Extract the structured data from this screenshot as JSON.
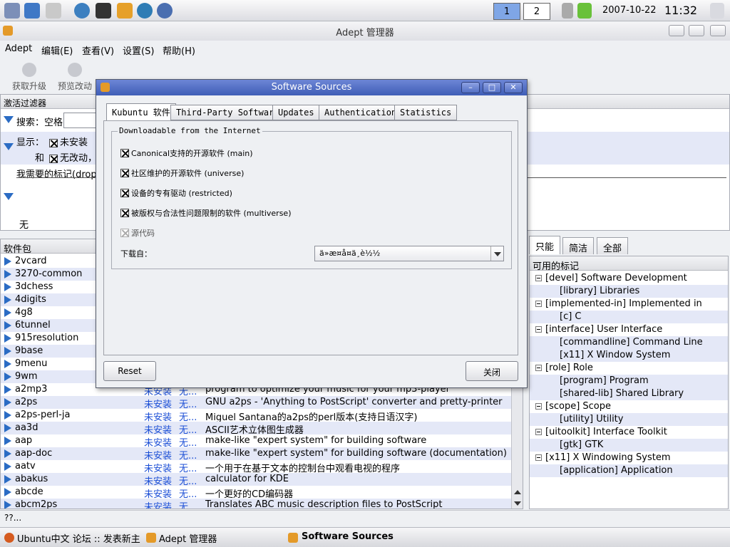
{
  "panel": {
    "launchers": [
      "ubuntu-menu-icon",
      "desktop-icon",
      "settings-icon",
      "konqueror-icon",
      "terminal-icon",
      "package-manager-icon",
      "konsole-icon",
      "network-icon"
    ],
    "desktop1": "1",
    "desktop2": "2",
    "date": "2007-10-22",
    "time": "11:32"
  },
  "window": {
    "title": "Adept 管理器"
  },
  "menu": {
    "items": [
      "Adept",
      "编辑(E)",
      "查看(V)",
      "设置(S)",
      "帮助(H)"
    ]
  },
  "toolbar": {
    "fetch_updates": "获取升级",
    "preview_changes": "预览改动"
  },
  "filter": {
    "header": "激活过滤器",
    "search_label": "搜索：空格",
    "show_label": "显示：",
    "not_installed": "未安装",
    "and_label": "和",
    "no_change": "无改动，",
    "tags_label": "我需要的标记(drop",
    "none": "无"
  },
  "pkglist": {
    "header": "软件包",
    "status_not_installed": "未安装",
    "action": "无...",
    "rows": [
      {
        "name": "2vcard",
        "desc": ""
      },
      {
        "name": "3270-common",
        "desc": ""
      },
      {
        "name": "3dchess",
        "desc": ""
      },
      {
        "name": "4digits",
        "desc": ""
      },
      {
        "name": "4g8",
        "desc": ""
      },
      {
        "name": "6tunnel",
        "desc": ""
      },
      {
        "name": "915resolution",
        "desc": ""
      },
      {
        "name": "9base",
        "desc": ""
      },
      {
        "name": "9menu",
        "desc": ""
      },
      {
        "name": "9wm",
        "desc": ""
      },
      {
        "name": "a2mp3",
        "desc": "program to optimize your music for your mp3-player"
      },
      {
        "name": "a2ps",
        "desc": "GNU a2ps - 'Anything to PostScript' converter and pretty-printer"
      },
      {
        "name": "a2ps-perl-ja",
        "desc": "Miguel Santana的a2ps的perl版本(支持日语汉字)"
      },
      {
        "name": "aa3d",
        "desc": "ASCII艺术立体图生成器"
      },
      {
        "name": "aap",
        "desc": "make-like \"expert system\" for building software"
      },
      {
        "name": "aap-doc",
        "desc": "make-like \"expert system\" for building software (documentation)"
      },
      {
        "name": "aatv",
        "desc": "一个用于在基于文本的控制台中观看电视的程序"
      },
      {
        "name": "abakus",
        "desc": "calculator for KDE"
      },
      {
        "name": "abcde",
        "desc": "一个更好的CD编码器"
      },
      {
        "name": "abcm2ps",
        "desc": "Translates ABC music description files to PostScript"
      }
    ]
  },
  "tags": {
    "tabs": [
      "只能",
      "简洁",
      "全部"
    ],
    "header": "可用的标记",
    "tree": [
      {
        "label": "[devel] Software Development",
        "level": 0
      },
      {
        "label": "[library] Libraries",
        "level": 1
      },
      {
        "label": "[implemented-in] Implemented in",
        "level": 0
      },
      {
        "label": "[c] C",
        "level": 1
      },
      {
        "label": "[interface] User Interface",
        "level": 0
      },
      {
        "label": "[commandline] Command Line",
        "level": 1
      },
      {
        "label": "[x11] X Window System",
        "level": 1
      },
      {
        "label": "[role] Role",
        "level": 0
      },
      {
        "label": "[program] Program",
        "level": 1
      },
      {
        "label": "[shared-lib] Shared Library",
        "level": 1
      },
      {
        "label": "[scope] Scope",
        "level": 0
      },
      {
        "label": "[utility] Utility",
        "level": 1
      },
      {
        "label": "[uitoolkit] Interface Toolkit",
        "level": 0
      },
      {
        "label": "[gtk] GTK",
        "level": 1
      },
      {
        "label": "[x11] X Windowing System",
        "level": 0
      },
      {
        "label": "[application] Application",
        "level": 1
      }
    ]
  },
  "status_text": "??...",
  "taskbar": {
    "task1": "Ubuntu中文 论坛 :: 发表新主",
    "task2": "Adept 管理器",
    "task3": "Software Sources"
  },
  "dialog": {
    "title": "Software Sources",
    "tabs": [
      "Kubuntu 软件",
      "Third-Party Software",
      "Updates",
      "Authentication",
      "Statistics"
    ],
    "group_title": "Downloadable from the Internet",
    "options": [
      {
        "label": "Canonical支持的开源软件 (main)",
        "checked": true
      },
      {
        "label": "社区维护的开源软件 (universe)",
        "checked": true
      },
      {
        "label": "设备的专有驱动 (restricted)",
        "checked": true
      },
      {
        "label": "被版权与合法性问题限制的软件 (multiverse)",
        "checked": true
      },
      {
        "label": "源代码",
        "checked": false
      }
    ],
    "download_from_label": "下载自：",
    "download_from_value": "ä»æ¤å¤ä¸è½½",
    "reset_button": "Reset",
    "close_button": "关闭"
  }
}
